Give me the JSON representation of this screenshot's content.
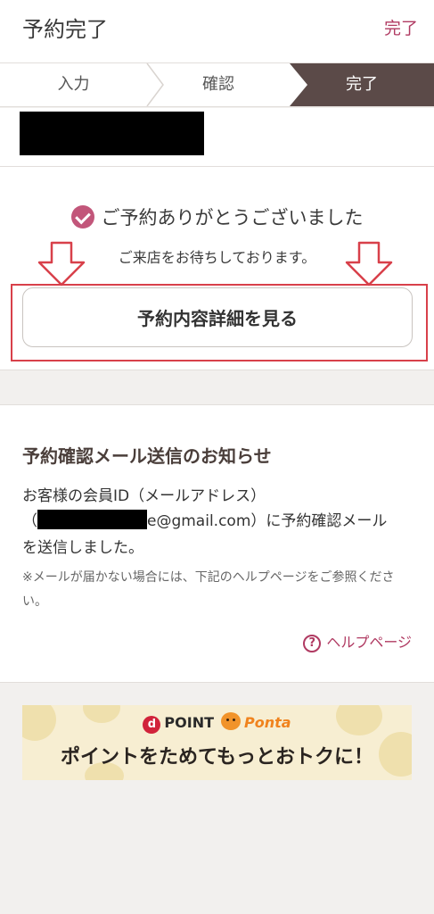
{
  "header": {
    "title": "予約完了",
    "done_label": "完了"
  },
  "stepper": {
    "steps": [
      {
        "label": "入力"
      },
      {
        "label": "確認"
      },
      {
        "label": "完了"
      }
    ],
    "active_color": "#5b4a48"
  },
  "completion": {
    "thanks_message": "ご予約ありがとうございました",
    "wait_message": "ご来店をお待ちしております。",
    "detail_button_label": "予約内容詳細を見る"
  },
  "notice": {
    "title": "予約確認メール送信のお知らせ",
    "line1": "お客様の会員ID（メールアドレス）",
    "line2_prefix": "（",
    "email_suffix": "e@gmail.com",
    "line2_suffix": "）に予約確認メール",
    "line3": "を送信しました。",
    "small_note": "※メールが届かない場合には、下記のヘルプページをご参照ください。",
    "help_link": "ヘルプページ"
  },
  "banner": {
    "dpoint": "POINT",
    "ponta": "Ponta",
    "slogan": "ポイントをためてもっとおトクに！"
  },
  "colors": {
    "accent": "#b03a62",
    "highlight": "#d8404a",
    "background": "#f2f0ee"
  }
}
